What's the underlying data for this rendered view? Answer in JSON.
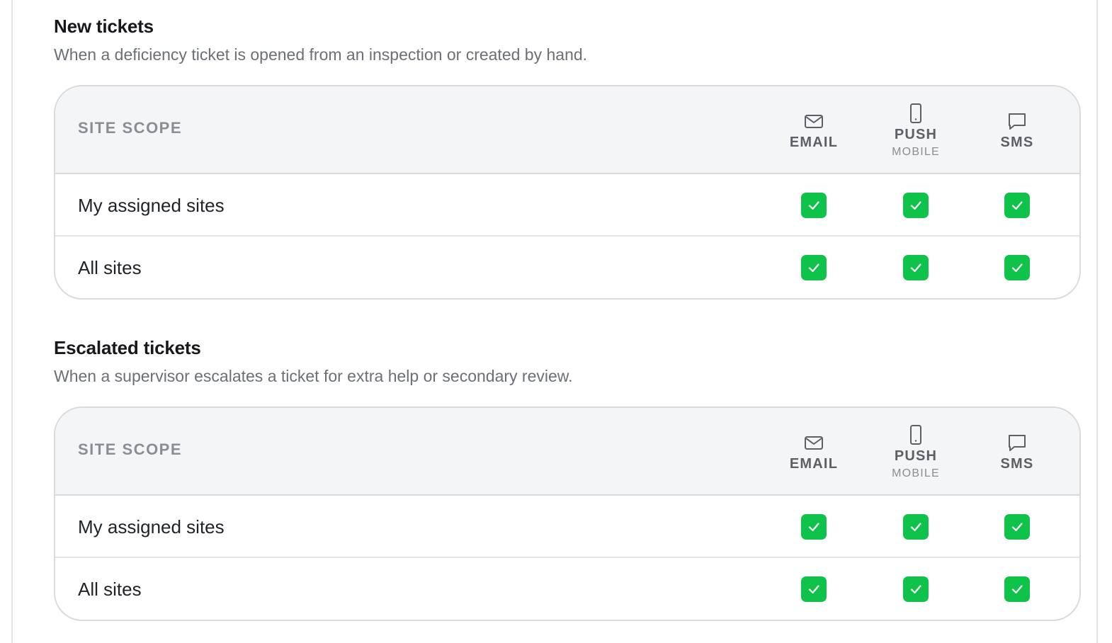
{
  "sections": [
    {
      "title": "New tickets",
      "description": "When a deficiency ticket is opened from an inspection or created by hand.",
      "scope_header": "SITE SCOPE",
      "columns": [
        {
          "icon": "mail-icon",
          "label": "EMAIL",
          "sub": ""
        },
        {
          "icon": "mobile-icon",
          "label": "PUSH",
          "sub": "MOBILE"
        },
        {
          "icon": "message-icon",
          "label": "SMS",
          "sub": ""
        }
      ],
      "rows": [
        {
          "label": "My assigned sites",
          "email": true,
          "push": true,
          "sms": true
        },
        {
          "label": "All sites",
          "email": true,
          "push": true,
          "sms": true
        }
      ]
    },
    {
      "title": "Escalated tickets",
      "description": "When a supervisor escalates a ticket for extra help or secondary review.",
      "scope_header": "SITE SCOPE",
      "columns": [
        {
          "icon": "mail-icon",
          "label": "EMAIL",
          "sub": ""
        },
        {
          "icon": "mobile-icon",
          "label": "PUSH",
          "sub": "MOBILE"
        },
        {
          "icon": "message-icon",
          "label": "SMS",
          "sub": ""
        }
      ],
      "rows": [
        {
          "label": "My assigned sites",
          "email": true,
          "push": true,
          "sms": true
        },
        {
          "label": "All sites",
          "email": true,
          "push": true,
          "sms": true
        }
      ]
    }
  ],
  "colors": {
    "check_on": "#0fc24a",
    "header_bg": "#f4f5f6",
    "border": "#d8dadd"
  }
}
